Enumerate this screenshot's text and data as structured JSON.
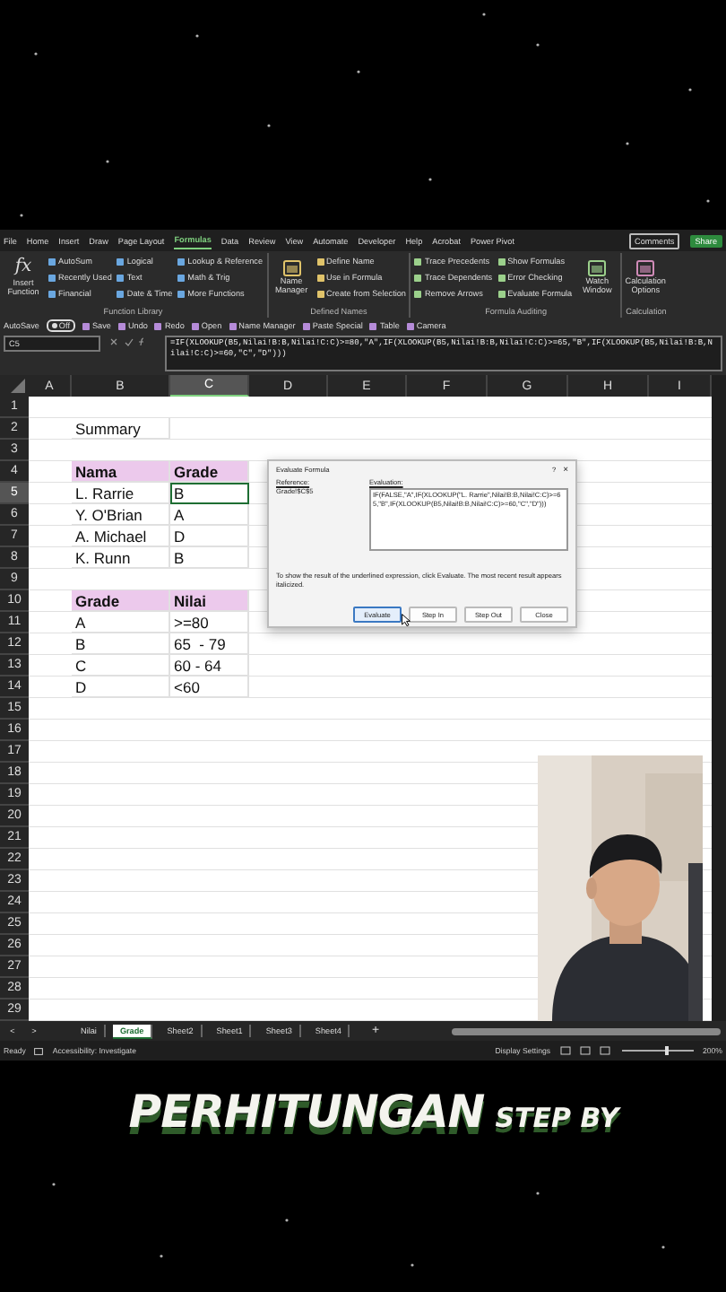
{
  "ribbon": {
    "tabs": [
      {
        "label": "File",
        "selected": false
      },
      {
        "label": "Home",
        "selected": false
      },
      {
        "label": "Insert",
        "selected": false
      },
      {
        "label": "Draw",
        "selected": false
      },
      {
        "label": "Page Layout",
        "selected": false
      },
      {
        "label": "Formulas",
        "selected": true
      },
      {
        "label": "Data",
        "selected": false
      },
      {
        "label": "Review",
        "selected": false
      },
      {
        "label": "View",
        "selected": false
      },
      {
        "label": "Automate",
        "selected": false
      },
      {
        "label": "Developer",
        "selected": false
      },
      {
        "label": "Help",
        "selected": false
      },
      {
        "label": "Acrobat",
        "selected": false
      },
      {
        "label": "Power Pivot",
        "selected": false
      }
    ],
    "comments": "Comments",
    "share": "Share",
    "groups": [
      {
        "label": "Function Library",
        "commands": [
          {
            "label": "Insert Function",
            "kind": "large",
            "symbol": "fx"
          },
          {
            "label": "AutoSum",
            "kind": "small"
          },
          {
            "label": "Recently Used",
            "kind": "small"
          },
          {
            "label": "Financial",
            "kind": "small"
          },
          {
            "label": "Logical",
            "kind": "small"
          },
          {
            "label": "Text",
            "kind": "small"
          },
          {
            "label": "Date & Time",
            "kind": "small"
          },
          {
            "label": "Lookup & Reference",
            "kind": "small"
          },
          {
            "label": "Math & Trig",
            "kind": "small"
          },
          {
            "label": "More Functions",
            "kind": "small"
          }
        ]
      },
      {
        "label": "Defined Names",
        "commands": [
          {
            "label": "Name Manager",
            "kind": "large"
          },
          {
            "label": "Define Name",
            "kind": "small"
          },
          {
            "label": "Use in Formula",
            "kind": "small"
          },
          {
            "label": "Create from Selection",
            "kind": "small"
          }
        ]
      },
      {
        "label": "Formula Auditing",
        "commands": [
          {
            "label": "Trace Precedents",
            "kind": "small"
          },
          {
            "label": "Trace Dependents",
            "kind": "small"
          },
          {
            "label": "Remove Arrows",
            "kind": "small"
          },
          {
            "label": "Show Formulas",
            "kind": "small"
          },
          {
            "label": "Error Checking",
            "kind": "small"
          },
          {
            "label": "Evaluate Formula",
            "kind": "small"
          },
          {
            "label": "Watch Window",
            "kind": "large"
          }
        ]
      },
      {
        "label": "Calculation",
        "commands": [
          {
            "label": "Calculation Options",
            "kind": "large"
          }
        ]
      }
    ],
    "quick_access": [
      {
        "label": "AutoSave",
        "kind": "toggle",
        "on": false,
        "state_text": "Off"
      },
      {
        "label": "Save",
        "kind": "command"
      },
      {
        "label": "Undo",
        "kind": "command"
      },
      {
        "label": "Redo",
        "kind": "command"
      },
      {
        "label": "Open",
        "kind": "command"
      },
      {
        "label": "Name Manager",
        "kind": "command"
      },
      {
        "label": "Paste Special",
        "kind": "command"
      },
      {
        "label": "Table",
        "kind": "command"
      },
      {
        "label": "Camera",
        "kind": "command"
      }
    ],
    "name_box": "C5",
    "formula": "=IF(XLOOKUP(B5,Nilai!B:B,Nilai!C:C)>=80,\"A\",IF(XLOOKUP(B5,Nilai!B:B,Nilai!C:C)>=65,\"B\",IF(XLOOKUP(B5,Nilai!B:B,Nilai!C:C)>=60,\"C\",\"D\")))"
  },
  "sheet": {
    "columns": [
      {
        "label": "A",
        "selected": false
      },
      {
        "label": "B",
        "selected": false
      },
      {
        "label": "C",
        "selected": true
      },
      {
        "label": "D",
        "selected": false
      },
      {
        "label": "E",
        "selected": false
      },
      {
        "label": "F",
        "selected": false
      },
      {
        "label": "G",
        "selected": false
      },
      {
        "label": "H",
        "selected": false
      },
      {
        "label": "I",
        "selected": false
      }
    ],
    "rows": [
      {
        "number": "1",
        "selected": false
      },
      {
        "number": "2",
        "selected": false,
        "cells": [
          {
            "text": "Summary",
            "kind": "plain",
            "selected": false
          }
        ]
      },
      {
        "number": "3",
        "selected": false
      },
      {
        "number": "4",
        "selected": false,
        "cells": [
          {
            "text": "Nama",
            "kind": "header",
            "selected": false
          },
          {
            "text": "Grade",
            "kind": "header",
            "selected": false
          }
        ]
      },
      {
        "number": "5",
        "selected": true,
        "cells": [
          {
            "text": "L. Rarrie",
            "kind": "plain",
            "selected": false
          },
          {
            "text": "B",
            "kind": "plain",
            "selected": true
          }
        ]
      },
      {
        "number": "6",
        "selected": false,
        "cells": [
          {
            "text": "Y. O'Brian",
            "kind": "plain",
            "selected": false
          },
          {
            "text": "A",
            "kind": "plain",
            "selected": false
          }
        ]
      },
      {
        "number": "7",
        "selected": false,
        "cells": [
          {
            "text": "A. Michael",
            "kind": "plain",
            "selected": false
          },
          {
            "text": "D",
            "kind": "plain",
            "selected": false
          }
        ]
      },
      {
        "number": "8",
        "selected": false,
        "cells": [
          {
            "text": "K. Runn",
            "kind": "plain",
            "selected": false
          },
          {
            "text": "B",
            "kind": "plain",
            "selected": false
          }
        ]
      },
      {
        "number": "9",
        "selected": false
      },
      {
        "number": "10",
        "selected": false,
        "cells": [
          {
            "text": "Grade",
            "kind": "header",
            "selected": false
          },
          {
            "text": "Nilai",
            "kind": "header",
            "selected": false
          }
        ]
      },
      {
        "number": "11",
        "selected": false,
        "cells": [
          {
            "text": "A",
            "kind": "plain",
            "selected": false
          },
          {
            "text": ">=80",
            "kind": "plain",
            "selected": false
          }
        ]
      },
      {
        "number": "12",
        "selected": false,
        "cells": [
          {
            "text": "B",
            "kind": "plain",
            "selected": false
          },
          {
            "text": "65  - 79",
            "kind": "plain",
            "selected": false
          }
        ]
      },
      {
        "number": "13",
        "selected": false,
        "cells": [
          {
            "text": "C",
            "kind": "plain",
            "selected": false
          },
          {
            "text": "60 - 64",
            "kind": "plain",
            "selected": false
          }
        ]
      },
      {
        "number": "14",
        "selected": false,
        "cells": [
          {
            "text": "D",
            "kind": "plain",
            "selected": false
          },
          {
            "text": "<60",
            "kind": "plain",
            "selected": false
          }
        ]
      },
      {
        "number": "15",
        "selected": false
      },
      {
        "number": "16",
        "selected": false
      },
      {
        "number": "17",
        "selected": false
      },
      {
        "number": "18",
        "selected": false
      },
      {
        "number": "19",
        "selected": false
      },
      {
        "number": "20",
        "selected": false
      },
      {
        "number": "21",
        "selected": false
      },
      {
        "number": "22",
        "selected": false
      },
      {
        "number": "23",
        "selected": false
      },
      {
        "number": "24",
        "selected": false
      },
      {
        "number": "25",
        "selected": false
      },
      {
        "number": "26",
        "selected": false
      },
      {
        "number": "27",
        "selected": false
      },
      {
        "number": "28",
        "selected": false
      },
      {
        "number": "29",
        "selected": false
      }
    ]
  },
  "dialog": {
    "title": "Evaluate Formula",
    "help": "?",
    "close": "×",
    "reference_label": "Reference:",
    "reference": "Grade!$C$5",
    "evaluation_label": "Evaluation:",
    "evaluation": "IF(FALSE,\"A\",IF(XLOOKUP(\"L. Rarrie\",Nilai!B:B,Nilai!C:C)>=65,\"B\",IF(XLOOKUP(B5,Nilai!B:B,Nilai!C:C)>=60,\"C\",\"D\")))",
    "note": "To show the result of the underlined expression, click Evaluate.  The most recent result appears italicized.",
    "buttons": [
      {
        "label": "Evaluate",
        "focused": true
      },
      {
        "label": "Step In",
        "focused": false
      },
      {
        "label": "Step Out",
        "focused": false
      },
      {
        "label": "Close",
        "focused": false
      }
    ]
  },
  "sheet_tabs": {
    "previous": "<",
    "next": ">",
    "add": "+",
    "tabs": [
      {
        "label": "Nilai",
        "selected": false
      },
      {
        "label": "Grade",
        "selected": true
      },
      {
        "label": "Sheet2",
        "selected": false
      },
      {
        "label": "Sheet1",
        "selected": false
      },
      {
        "label": "Sheet3",
        "selected": false
      },
      {
        "label": "Sheet4",
        "selected": false
      }
    ]
  },
  "status_bar": {
    "status": "Ready",
    "accessibility": "Accessibility: Investigate",
    "display_settings": "Display Settings",
    "zoom": "200%",
    "zoom_level": {
      "level": 0.6
    }
  },
  "caption": {
    "headline": "PERHITUNGAN",
    "subline": "STEP BY"
  }
}
